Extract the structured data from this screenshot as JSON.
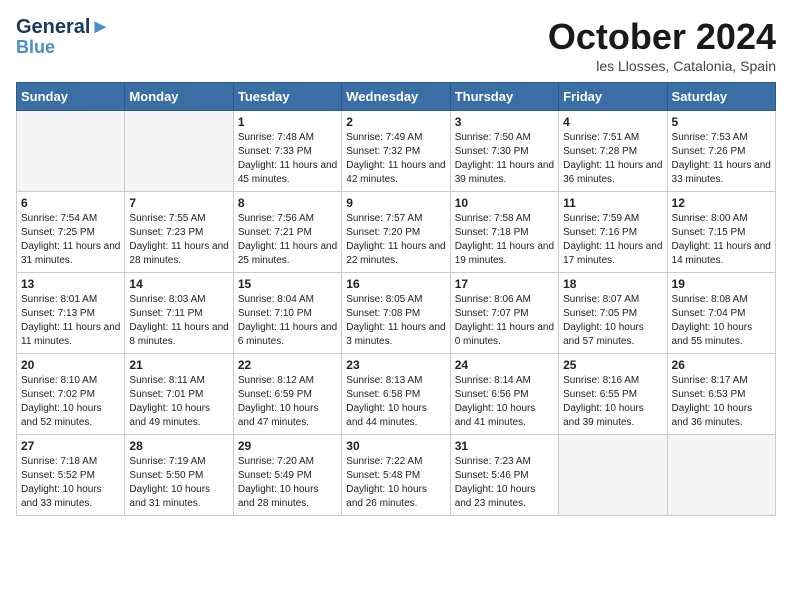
{
  "header": {
    "logo_line1": "General",
    "logo_line2": "Blue",
    "month_title": "October 2024",
    "location": "les Llosses, Catalonia, Spain"
  },
  "weekdays": [
    "Sunday",
    "Monday",
    "Tuesday",
    "Wednesday",
    "Thursday",
    "Friday",
    "Saturday"
  ],
  "weeks": [
    [
      {
        "day": "",
        "empty": true
      },
      {
        "day": "",
        "empty": true
      },
      {
        "day": "1",
        "sunrise": "7:48 AM",
        "sunset": "7:33 PM",
        "daylight": "11 hours and 45 minutes."
      },
      {
        "day": "2",
        "sunrise": "7:49 AM",
        "sunset": "7:32 PM",
        "daylight": "11 hours and 42 minutes."
      },
      {
        "day": "3",
        "sunrise": "7:50 AM",
        "sunset": "7:30 PM",
        "daylight": "11 hours and 39 minutes."
      },
      {
        "day": "4",
        "sunrise": "7:51 AM",
        "sunset": "7:28 PM",
        "daylight": "11 hours and 36 minutes."
      },
      {
        "day": "5",
        "sunrise": "7:53 AM",
        "sunset": "7:26 PM",
        "daylight": "11 hours and 33 minutes."
      }
    ],
    [
      {
        "day": "6",
        "sunrise": "7:54 AM",
        "sunset": "7:25 PM",
        "daylight": "11 hours and 31 minutes."
      },
      {
        "day": "7",
        "sunrise": "7:55 AM",
        "sunset": "7:23 PM",
        "daylight": "11 hours and 28 minutes."
      },
      {
        "day": "8",
        "sunrise": "7:56 AM",
        "sunset": "7:21 PM",
        "daylight": "11 hours and 25 minutes."
      },
      {
        "day": "9",
        "sunrise": "7:57 AM",
        "sunset": "7:20 PM",
        "daylight": "11 hours and 22 minutes."
      },
      {
        "day": "10",
        "sunrise": "7:58 AM",
        "sunset": "7:18 PM",
        "daylight": "11 hours and 19 minutes."
      },
      {
        "day": "11",
        "sunrise": "7:59 AM",
        "sunset": "7:16 PM",
        "daylight": "11 hours and 17 minutes."
      },
      {
        "day": "12",
        "sunrise": "8:00 AM",
        "sunset": "7:15 PM",
        "daylight": "11 hours and 14 minutes."
      }
    ],
    [
      {
        "day": "13",
        "sunrise": "8:01 AM",
        "sunset": "7:13 PM",
        "daylight": "11 hours and 11 minutes."
      },
      {
        "day": "14",
        "sunrise": "8:03 AM",
        "sunset": "7:11 PM",
        "daylight": "11 hours and 8 minutes."
      },
      {
        "day": "15",
        "sunrise": "8:04 AM",
        "sunset": "7:10 PM",
        "daylight": "11 hours and 6 minutes."
      },
      {
        "day": "16",
        "sunrise": "8:05 AM",
        "sunset": "7:08 PM",
        "daylight": "11 hours and 3 minutes."
      },
      {
        "day": "17",
        "sunrise": "8:06 AM",
        "sunset": "7:07 PM",
        "daylight": "11 hours and 0 minutes."
      },
      {
        "day": "18",
        "sunrise": "8:07 AM",
        "sunset": "7:05 PM",
        "daylight": "10 hours and 57 minutes."
      },
      {
        "day": "19",
        "sunrise": "8:08 AM",
        "sunset": "7:04 PM",
        "daylight": "10 hours and 55 minutes."
      }
    ],
    [
      {
        "day": "20",
        "sunrise": "8:10 AM",
        "sunset": "7:02 PM",
        "daylight": "10 hours and 52 minutes."
      },
      {
        "day": "21",
        "sunrise": "8:11 AM",
        "sunset": "7:01 PM",
        "daylight": "10 hours and 49 minutes."
      },
      {
        "day": "22",
        "sunrise": "8:12 AM",
        "sunset": "6:59 PM",
        "daylight": "10 hours and 47 minutes."
      },
      {
        "day": "23",
        "sunrise": "8:13 AM",
        "sunset": "6:58 PM",
        "daylight": "10 hours and 44 minutes."
      },
      {
        "day": "24",
        "sunrise": "8:14 AM",
        "sunset": "6:56 PM",
        "daylight": "10 hours and 41 minutes."
      },
      {
        "day": "25",
        "sunrise": "8:16 AM",
        "sunset": "6:55 PM",
        "daylight": "10 hours and 39 minutes."
      },
      {
        "day": "26",
        "sunrise": "8:17 AM",
        "sunset": "6:53 PM",
        "daylight": "10 hours and 36 minutes."
      }
    ],
    [
      {
        "day": "27",
        "sunrise": "7:18 AM",
        "sunset": "5:52 PM",
        "daylight": "10 hours and 33 minutes."
      },
      {
        "day": "28",
        "sunrise": "7:19 AM",
        "sunset": "5:50 PM",
        "daylight": "10 hours and 31 minutes."
      },
      {
        "day": "29",
        "sunrise": "7:20 AM",
        "sunset": "5:49 PM",
        "daylight": "10 hours and 28 minutes."
      },
      {
        "day": "30",
        "sunrise": "7:22 AM",
        "sunset": "5:48 PM",
        "daylight": "10 hours and 26 minutes."
      },
      {
        "day": "31",
        "sunrise": "7:23 AM",
        "sunset": "5:46 PM",
        "daylight": "10 hours and 23 minutes."
      },
      {
        "day": "",
        "empty": true
      },
      {
        "day": "",
        "empty": true
      }
    ]
  ]
}
